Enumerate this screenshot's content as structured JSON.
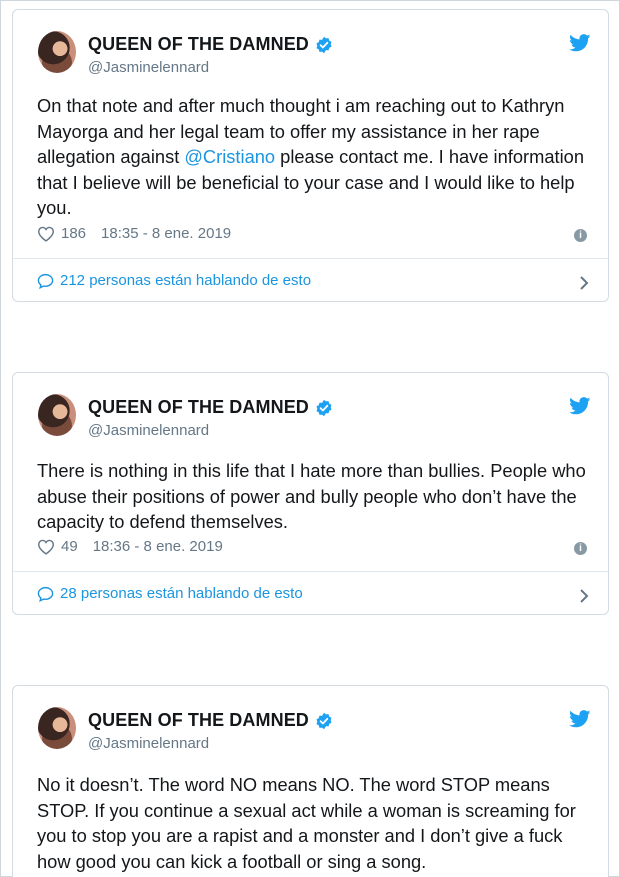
{
  "tweets": [
    {
      "author": "QUEEN OF THE DAMNED",
      "handle": "@Jasminelennard",
      "text_before": "On that note and after much thought i am reaching out to Kathryn Mayorga and her legal team to offer my assistance in her rape allegation against ",
      "mention": "@Cristiano",
      "text_after": " please contact me. I have information that I believe will be beneficial to your case and I would like to help you.",
      "likes": "186",
      "timestamp": "18:35 - 8 ene. 2019",
      "talking": "212 personas están hablando de esto"
    },
    {
      "author": "QUEEN OF THE DAMNED",
      "handle": "@Jasminelennard",
      "text": "There is nothing in this life that I hate more than bullies. People who abuse their positions of power and bully people who don’t have the capacity to defend themselves.",
      "likes": "49",
      "timestamp": "18:36 - 8 ene. 2019",
      "talking": "28 personas están hablando de esto"
    },
    {
      "author": "QUEEN OF THE DAMNED",
      "handle": "@Jasminelennard",
      "text": "No it doesn’t. The word NO means NO. The word STOP means STOP. If you continue a sexual act while a woman is screaming for you to stop you are a rapist and a monster and I don’t give a fuck how good you can kick a football or sing a song."
    }
  ],
  "colors": {
    "link": "#1b95e0",
    "muted": "#657786",
    "border": "#d5dbe0",
    "twitter_blue": "#1da1f2"
  },
  "icons": [
    "verified-badge-icon",
    "twitter-bird-icon",
    "heart-icon",
    "info-icon",
    "speech-bubble-icon",
    "chevron-right-icon"
  ]
}
